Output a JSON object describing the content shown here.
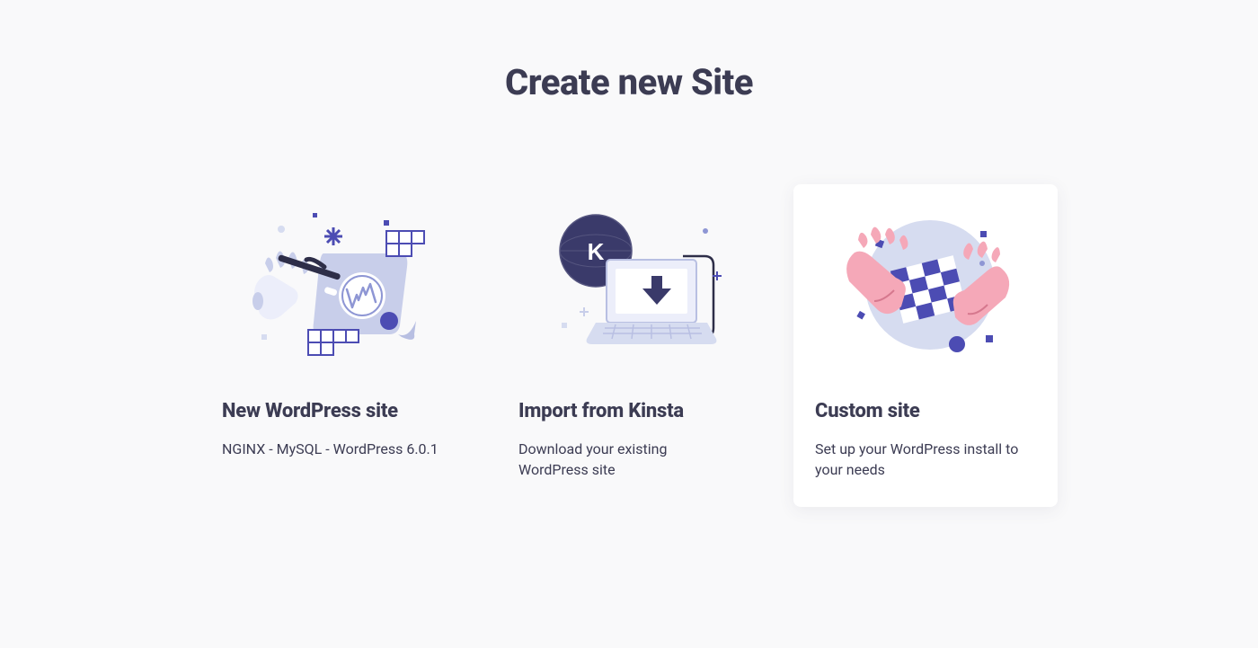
{
  "page": {
    "title": "Create new Site"
  },
  "options": [
    {
      "id": "new-wordpress",
      "title": "New WordPress site",
      "description": "NGINX - MySQL - WordPress 6.0.1",
      "hover": false
    },
    {
      "id": "import-kinsta",
      "title": "Import from Kinsta",
      "description": "Download your existing WordPress site",
      "hover": false
    },
    {
      "id": "custom-site",
      "title": "Custom site",
      "description": "Set up your WordPress install to your needs",
      "hover": true
    }
  ],
  "colors": {
    "text": "#3c3c53",
    "accent": "#4c4cb3",
    "pastelBlue": "#d6dcf0",
    "pink": "#f5a8b8",
    "pageBg": "#f9f9fa"
  }
}
